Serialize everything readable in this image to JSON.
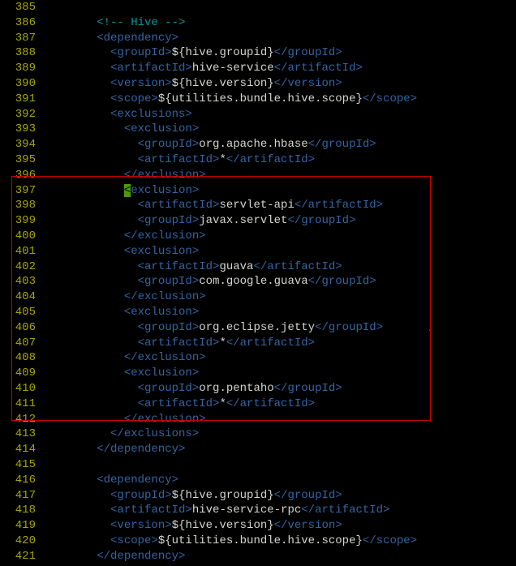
{
  "lines": [
    {
      "num": "385",
      "segments": []
    },
    {
      "num": "386",
      "segments": [
        {
          "cls": "comment",
          "t": "        <!-- Hive -->"
        }
      ]
    },
    {
      "num": "387",
      "segments": [
        {
          "cls": "tag",
          "t": "        <dependency>"
        }
      ]
    },
    {
      "num": "388",
      "segments": [
        {
          "cls": "tag",
          "t": "          <groupId>"
        },
        {
          "cls": "text",
          "t": "${hive.groupid}"
        },
        {
          "cls": "tag",
          "t": "</groupId>"
        }
      ]
    },
    {
      "num": "389",
      "segments": [
        {
          "cls": "tag",
          "t": "          <artifactId>"
        },
        {
          "cls": "text",
          "t": "hive-service"
        },
        {
          "cls": "tag",
          "t": "</artifactId>"
        }
      ]
    },
    {
      "num": "390",
      "segments": [
        {
          "cls": "tag",
          "t": "          <version>"
        },
        {
          "cls": "text",
          "t": "${hive.version}"
        },
        {
          "cls": "tag",
          "t": "</version>"
        }
      ]
    },
    {
      "num": "391",
      "segments": [
        {
          "cls": "tag",
          "t": "          <scope>"
        },
        {
          "cls": "text",
          "t": "${utilities.bundle.hive.scope}"
        },
        {
          "cls": "tag",
          "t": "</scope>"
        }
      ]
    },
    {
      "num": "392",
      "segments": [
        {
          "cls": "tag",
          "t": "          <exclusions>"
        }
      ]
    },
    {
      "num": "393",
      "segments": [
        {
          "cls": "tag",
          "t": "            <exclusion>"
        }
      ]
    },
    {
      "num": "394",
      "segments": [
        {
          "cls": "tag",
          "t": "              <groupId>"
        },
        {
          "cls": "text",
          "t": "org.apache.hbase"
        },
        {
          "cls": "tag",
          "t": "</groupId>"
        }
      ]
    },
    {
      "num": "395",
      "segments": [
        {
          "cls": "tag",
          "t": "              <artifactId>"
        },
        {
          "cls": "text",
          "t": "*"
        },
        {
          "cls": "tag",
          "t": "</artifactId>"
        }
      ]
    },
    {
      "num": "396",
      "segments": [
        {
          "cls": "tag",
          "t": "            </exclusion>"
        }
      ]
    },
    {
      "num": "397",
      "segments": [
        {
          "cls": "tag",
          "t": "            "
        },
        {
          "cls": "cursor",
          "t": "<"
        },
        {
          "cls": "tag",
          "t": "exclusion>"
        }
      ]
    },
    {
      "num": "398",
      "segments": [
        {
          "cls": "tag",
          "t": "              <artifactId>"
        },
        {
          "cls": "text",
          "t": "servlet-api"
        },
        {
          "cls": "tag",
          "t": "</artifactId>"
        }
      ]
    },
    {
      "num": "399",
      "segments": [
        {
          "cls": "tag",
          "t": "              <groupId>"
        },
        {
          "cls": "text",
          "t": "javax.servlet"
        },
        {
          "cls": "tag",
          "t": "</groupId>"
        }
      ]
    },
    {
      "num": "400",
      "segments": [
        {
          "cls": "tag",
          "t": "            </exclusion>"
        }
      ]
    },
    {
      "num": "401",
      "segments": [
        {
          "cls": "tag",
          "t": "            <exclusion>"
        }
      ]
    },
    {
      "num": "402",
      "segments": [
        {
          "cls": "tag",
          "t": "              <artifactId>"
        },
        {
          "cls": "text",
          "t": "guava"
        },
        {
          "cls": "tag",
          "t": "</artifactId>"
        }
      ]
    },
    {
      "num": "403",
      "segments": [
        {
          "cls": "tag",
          "t": "              <groupId>"
        },
        {
          "cls": "text",
          "t": "com.google.guava"
        },
        {
          "cls": "tag",
          "t": "</groupId>"
        }
      ]
    },
    {
      "num": "404",
      "segments": [
        {
          "cls": "tag",
          "t": "            </exclusion>"
        }
      ]
    },
    {
      "num": "405",
      "segments": [
        {
          "cls": "tag",
          "t": "            <exclusion>"
        }
      ]
    },
    {
      "num": "406",
      "segments": [
        {
          "cls": "tag",
          "t": "              <groupId>"
        },
        {
          "cls": "text",
          "t": "org.eclipse.jetty"
        },
        {
          "cls": "tag",
          "t": "</groupId>"
        }
      ]
    },
    {
      "num": "407",
      "segments": [
        {
          "cls": "tag",
          "t": "              <artifactId>"
        },
        {
          "cls": "text",
          "t": "*"
        },
        {
          "cls": "tag",
          "t": "</artifactId>"
        }
      ]
    },
    {
      "num": "408",
      "segments": [
        {
          "cls": "tag",
          "t": "            </exclusion>"
        }
      ]
    },
    {
      "num": "409",
      "segments": [
        {
          "cls": "tag",
          "t": "            <exclusion>"
        }
      ]
    },
    {
      "num": "410",
      "segments": [
        {
          "cls": "tag",
          "t": "              <groupId>"
        },
        {
          "cls": "text",
          "t": "org.pentaho"
        },
        {
          "cls": "tag",
          "t": "</groupId>"
        }
      ]
    },
    {
      "num": "411",
      "segments": [
        {
          "cls": "tag",
          "t": "              <artifactId>"
        },
        {
          "cls": "text",
          "t": "*"
        },
        {
          "cls": "tag",
          "t": "</artifactId>"
        }
      ]
    },
    {
      "num": "412",
      "segments": [
        {
          "cls": "tag",
          "t": "            </exclusion>"
        }
      ]
    },
    {
      "num": "413",
      "segments": [
        {
          "cls": "tag",
          "t": "          </exclusions>"
        }
      ]
    },
    {
      "num": "414",
      "segments": [
        {
          "cls": "tag",
          "t": "        </dependency>"
        }
      ]
    },
    {
      "num": "415",
      "segments": []
    },
    {
      "num": "416",
      "segments": [
        {
          "cls": "tag",
          "t": "        <dependency>"
        }
      ]
    },
    {
      "num": "417",
      "segments": [
        {
          "cls": "tag",
          "t": "          <groupId>"
        },
        {
          "cls": "text",
          "t": "${hive.groupid}"
        },
        {
          "cls": "tag",
          "t": "</groupId>"
        }
      ]
    },
    {
      "num": "418",
      "segments": [
        {
          "cls": "tag",
          "t": "          <artifactId>"
        },
        {
          "cls": "text",
          "t": "hive-service-rpc"
        },
        {
          "cls": "tag",
          "t": "</artifactId>"
        }
      ]
    },
    {
      "num": "419",
      "segments": [
        {
          "cls": "tag",
          "t": "          <version>"
        },
        {
          "cls": "text",
          "t": "${hive.version}"
        },
        {
          "cls": "tag",
          "t": "</version>"
        }
      ]
    },
    {
      "num": "420",
      "segments": [
        {
          "cls": "tag",
          "t": "          <scope>"
        },
        {
          "cls": "text",
          "t": "${utilities.bundle.hive.scope}"
        },
        {
          "cls": "tag",
          "t": "</scope>"
        }
      ]
    },
    {
      "num": "421",
      "segments": [
        {
          "cls": "tag",
          "t": "        </dependency>"
        }
      ]
    }
  ]
}
